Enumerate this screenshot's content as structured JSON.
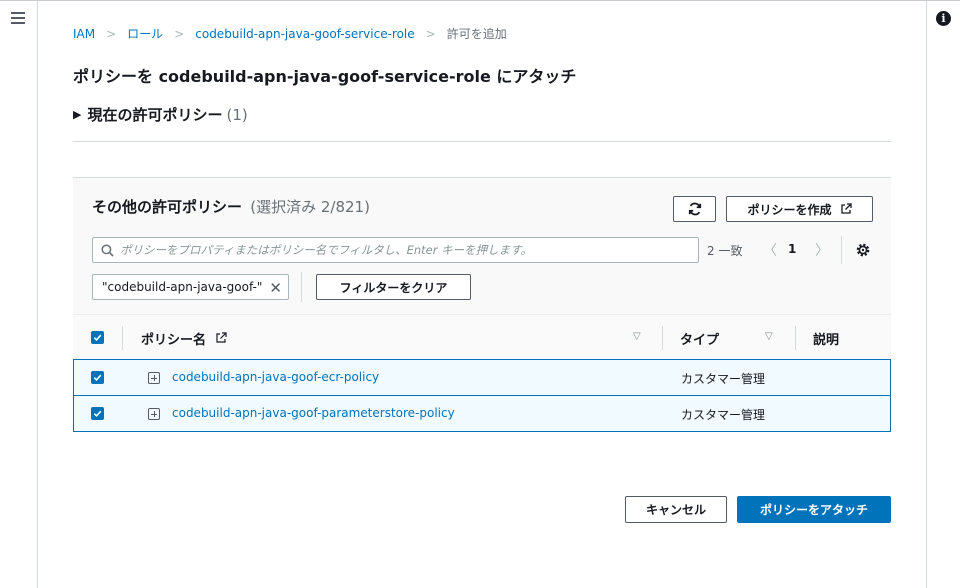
{
  "breadcrumb": {
    "items": [
      "IAM",
      "ロール",
      "codebuild-apn-java-goof-service-role"
    ],
    "current": "許可を追加",
    "separator": ">"
  },
  "page_title": "ポリシーを codebuild-apn-java-goof-service-role にアタッチ",
  "current_policies": {
    "label": "現在の許可ポリシー",
    "count": "(1)"
  },
  "other_policies": {
    "title": "その他の許可ポリシー",
    "subtitle": "(選択済み 2/821)",
    "refresh_icon": "refresh-icon",
    "create_label": "ポリシーを作成",
    "search_placeholder": "ポリシーをプロパティまたはポリシー名でフィルタし、Enter キーを押します。",
    "match_count": "2 一致",
    "page": "1",
    "filter_token": "\"codebuild-apn-java-goof-\"",
    "clear_filter_label": "フィルターをクリア",
    "columns": {
      "name": "ポリシー名",
      "type": "タイプ",
      "description": "説明"
    },
    "rows": [
      {
        "name": "codebuild-apn-java-goof-ecr-policy",
        "type": "カスタマー管理"
      },
      {
        "name": "codebuild-apn-java-goof-parameterstore-policy",
        "type": "カスタマー管理"
      }
    ]
  },
  "footer": {
    "cancel_label": "キャンセル",
    "attach_label": "ポリシーをアタッチ"
  },
  "colors": {
    "accent": "#0073bb",
    "border": "#d5dbdb",
    "text": "#16191f"
  }
}
